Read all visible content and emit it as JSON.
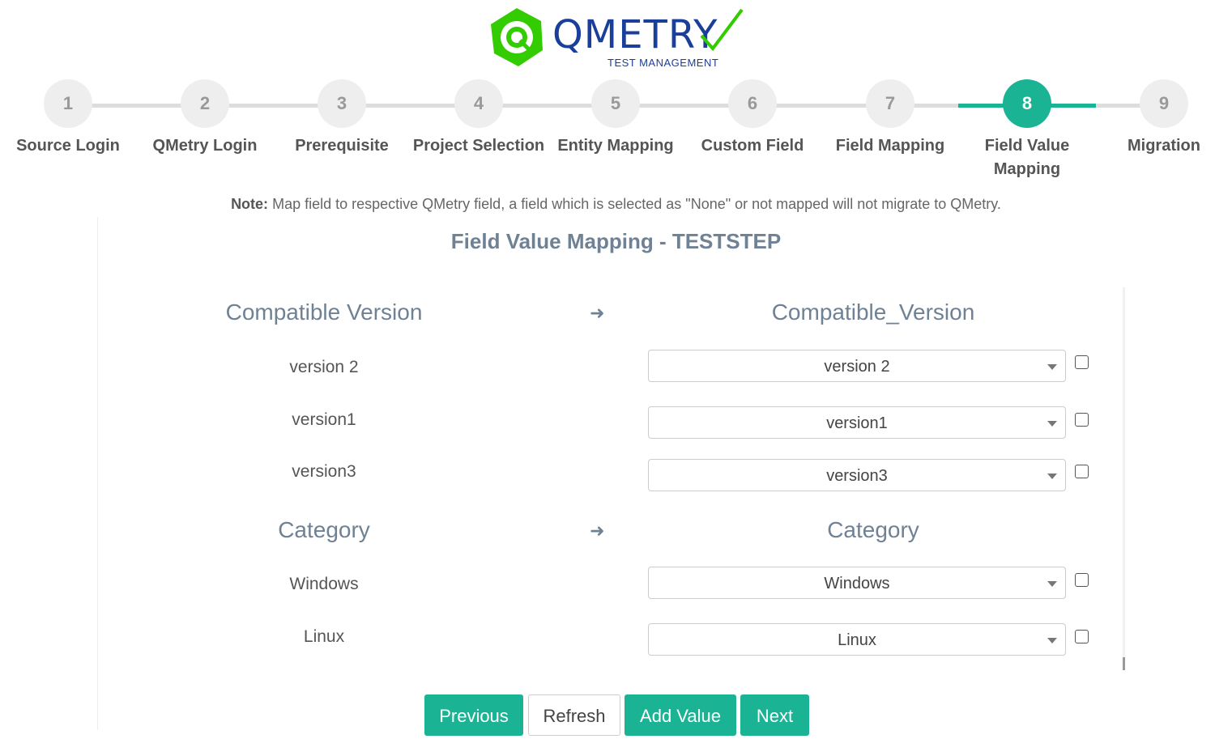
{
  "brand": {
    "name": "QMETRY",
    "tagline": "TEST MANAGEMENT",
    "logo_color": "#33cc00",
    "text_color": "#1a3f9a"
  },
  "stepper": {
    "active_step": 8,
    "accent": "#1ab394",
    "steps": [
      {
        "number": "1",
        "label": "Source Login"
      },
      {
        "number": "2",
        "label": "QMetry Login"
      },
      {
        "number": "3",
        "label": "Prerequisite"
      },
      {
        "number": "4",
        "label": "Project Selection"
      },
      {
        "number": "5",
        "label": "Entity Mapping"
      },
      {
        "number": "6",
        "label": "Custom Field"
      },
      {
        "number": "7",
        "label": "Field Mapping"
      },
      {
        "number": "8",
        "label": "Field Value Mapping"
      },
      {
        "number": "9",
        "label": "Migration"
      }
    ]
  },
  "note": {
    "prefix": "Note:",
    "text": "Map field to respective QMetry field, a field which is selected as \"None\" or not mapped will not migrate to QMetry."
  },
  "section_title": "Field Value Mapping - TESTSTEP",
  "groups": [
    {
      "source_field": "Compatible Version",
      "target_field": "Compatible_Version",
      "arrow_icon": "arrow-right-icon",
      "rows": [
        {
          "source": "version 2",
          "selected": "version 2",
          "checked": false
        },
        {
          "source": "version1",
          "selected": "version1",
          "checked": false
        },
        {
          "source": "version3",
          "selected": "version3",
          "checked": false
        }
      ]
    },
    {
      "source_field": "Category",
      "target_field": "Category",
      "arrow_icon": "arrow-right-icon",
      "rows": [
        {
          "source": "Windows",
          "selected": "Windows",
          "checked": false
        },
        {
          "source": "Linux",
          "selected": "Linux",
          "checked": false
        }
      ]
    }
  ],
  "buttons": {
    "previous": "Previous",
    "refresh": "Refresh",
    "add_value": "Add Value",
    "next": "Next"
  }
}
